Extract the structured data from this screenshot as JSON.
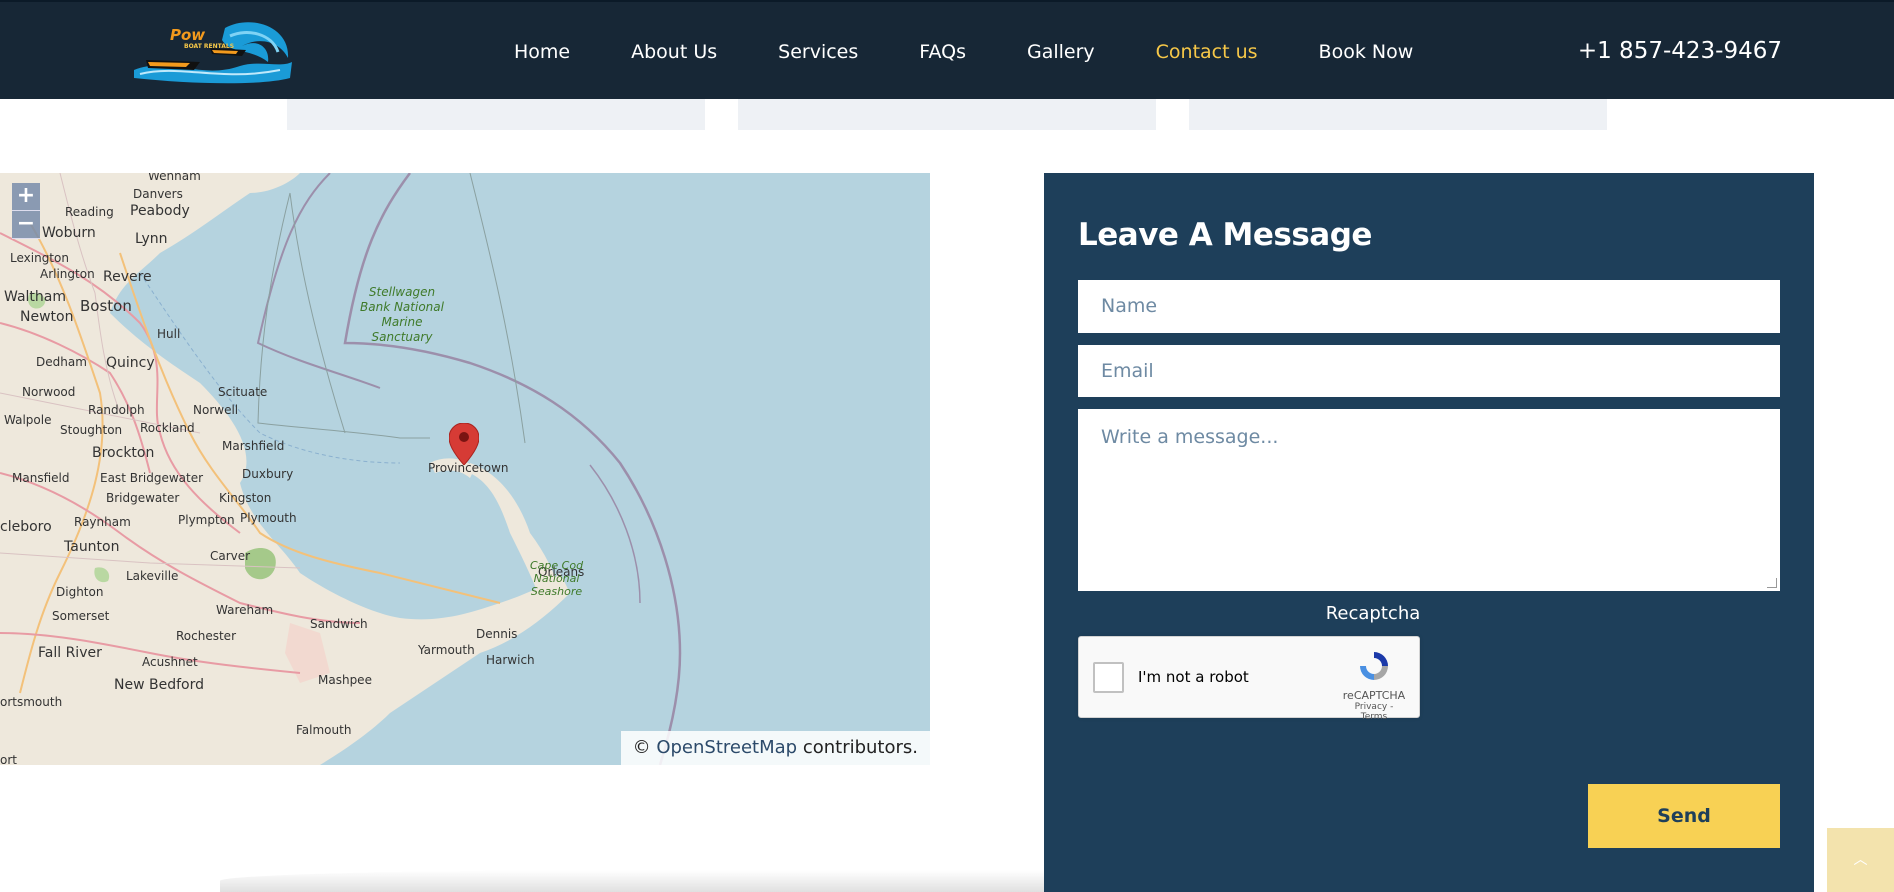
{
  "header": {
    "nav": [
      "Home",
      "About Us",
      "Services",
      "FAQs",
      "Gallery",
      "Contact us",
      "Book Now"
    ],
    "active": "Contact us",
    "phone": "+1 857-423-9467"
  },
  "map": {
    "zoom_in": "+",
    "zoom_out": "−",
    "attribution_prefix": "©",
    "attribution_link": "OpenStreetMap",
    "attribution_suffix": "contributors.",
    "labels": {
      "wenham": "Wenham",
      "danvers": "Danvers",
      "peabody": "Peabody",
      "reading": "Reading",
      "woburn": "Woburn",
      "lynn": "Lynn",
      "lexington": "Lexington",
      "arlington": "Arlington",
      "revere": "Revere",
      "waltham": "Waltham",
      "boston": "Boston",
      "newton": "Newton",
      "hull": "Hull",
      "dedham": "Dedham",
      "quincy": "Quincy",
      "norwood": "Norwood",
      "scituate": "Scituate",
      "norwell": "Norwell",
      "randolph": "Randolph",
      "walpole": "Walpole",
      "stoughton": "Stoughton",
      "rockland": "Rockland",
      "brockton": "Brockton",
      "marshfield": "Marshfield",
      "mansfield": "Mansfield",
      "east_bridgewater": "East Bridgewater",
      "duxbury": "Duxbury",
      "bridgewater": "Bridgewater",
      "kingston": "Kingston",
      "raynham": "Raynham",
      "plympton": "Plympton",
      "plymouth": "Plymouth",
      "cleboro": "cleboro",
      "taunton": "Taunton",
      "carver": "Carver",
      "lakeville": "Lakeville",
      "dighton": "Dighton",
      "wareham": "Wareham",
      "somerset": "Somerset",
      "rochester": "Rochester",
      "sandwich": "Sandwich",
      "dennis": "Dennis",
      "yarmouth": "Yarmouth",
      "harwich": "Harwich",
      "fall_river": "Fall River",
      "acushnet": "Acushnet",
      "mashpee": "Mashpee",
      "new_bedford": "New Bedford",
      "ortsmouth": "ortsmouth",
      "falmouth": "Falmouth",
      "ort": "ort",
      "orleans": "Orleans",
      "provincetown": "Provincetown",
      "stellwagen": [
        "Stellwagen",
        "Bank National",
        "Marine",
        "Sanctuary"
      ],
      "cape_cod": [
        "Cape Cod",
        "National",
        "Seashore"
      ]
    }
  },
  "form": {
    "title": "Leave A Message",
    "name_placeholder": "Name",
    "email_placeholder": "Email",
    "message_placeholder": "Write a message...",
    "recaptcha_title": "Recaptcha",
    "recaptcha_label": "I'm not a robot",
    "recaptcha_brand": "reCAPTCHA",
    "recaptcha_links": "Privacy - Terms",
    "send_label": "Send"
  },
  "scroll_top_icon": "chevron-up-icon",
  "colors": {
    "header_bg": "#0f2030",
    "active_nav": "#f7c848",
    "panel_bg": "#1e3f5a",
    "send_bg": "#f8d154",
    "map_water": "#b5d3df"
  }
}
